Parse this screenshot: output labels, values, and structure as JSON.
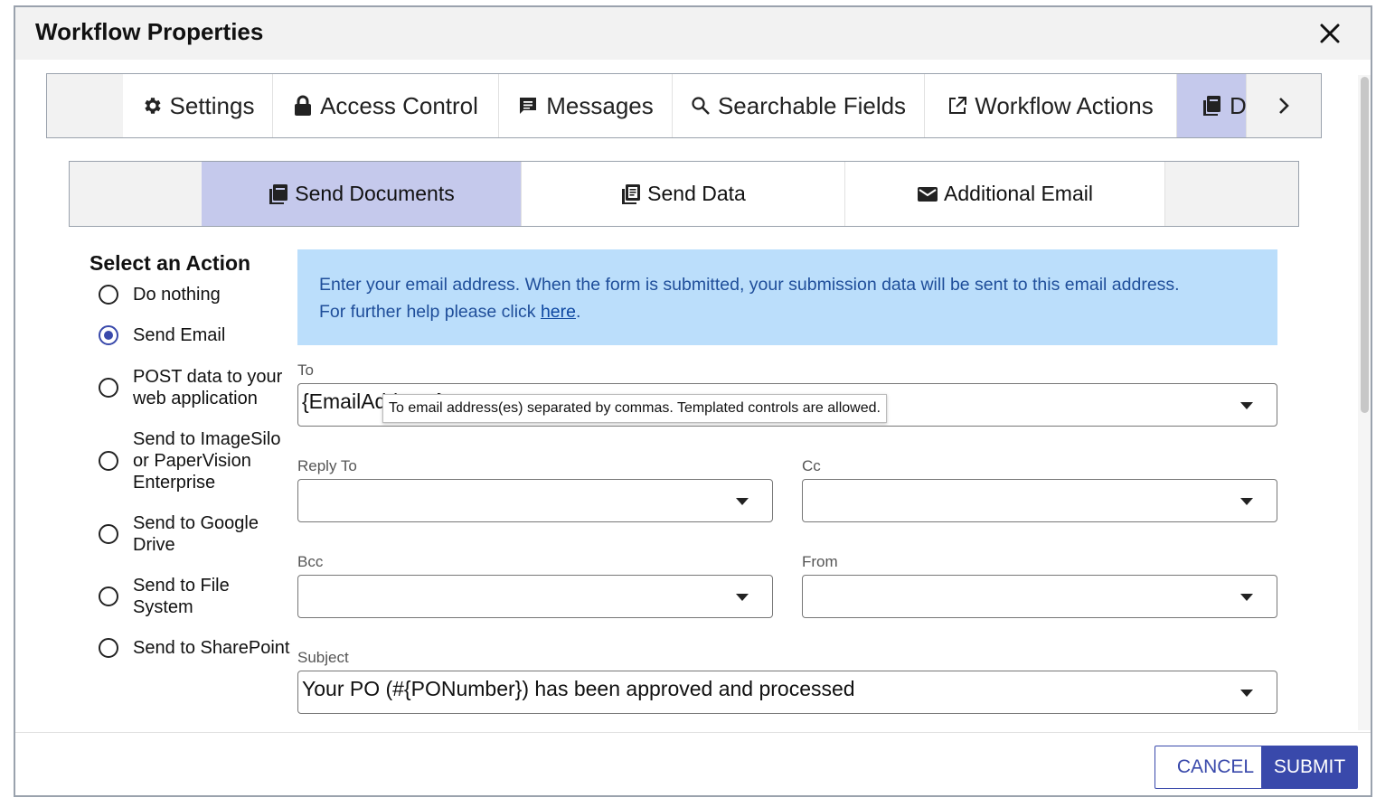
{
  "dialog": {
    "title": "Workflow Properties"
  },
  "primary_tabs": [
    {
      "label": "Settings",
      "icon": "gear-icon"
    },
    {
      "label": "Access Control",
      "icon": "lock-icon"
    },
    {
      "label": "Messages",
      "icon": "message-icon"
    },
    {
      "label": "Searchable Fields",
      "icon": "search-icon"
    },
    {
      "label": "Workflow Actions",
      "icon": "open-in-new-icon"
    },
    {
      "label": "D",
      "icon": "document-icon",
      "active": true
    }
  ],
  "sub_tabs": [
    {
      "label": "Send Documents",
      "icon": "document-icon",
      "active": true
    },
    {
      "label": "Send Data",
      "icon": "data-icon"
    },
    {
      "label": "Additional Email",
      "icon": "envelope-icon"
    }
  ],
  "actions": {
    "title": "Select an Action",
    "selected": "Send Email",
    "options": [
      "Do nothing",
      "Send Email",
      "POST data to your web application",
      "Send to ImageSilo or PaperVision Enterprise",
      "Send to Google Drive",
      "Send to File System",
      "Send to SharePoint"
    ]
  },
  "info": {
    "line1": "Enter your email address. When the form is submitted, your submission data will be sent to this email address.",
    "line2_prefix": "For further help please click ",
    "link": "here",
    "line2_suffix": "."
  },
  "fields": {
    "to": {
      "label": "To",
      "value": "{EmailAddress}"
    },
    "reply_to": {
      "label": "Reply To",
      "value": ""
    },
    "cc": {
      "label": "Cc",
      "value": ""
    },
    "bcc": {
      "label": "Bcc",
      "value": ""
    },
    "from": {
      "label": "From",
      "value": ""
    },
    "subject": {
      "label": "Subject",
      "value": "Your PO (#{PONumber}) has been approved and processed"
    }
  },
  "tooltip": "To email address(es) separated by commas.  Templated controls are allowed.",
  "footer": {
    "cancel": "CANCEL",
    "submit": "SUBMIT"
  },
  "colors": {
    "accent": "#3949ab",
    "active_tab": "#c5c9ec",
    "info_bg": "#bbdefb",
    "info_text": "#1f4e9a"
  }
}
